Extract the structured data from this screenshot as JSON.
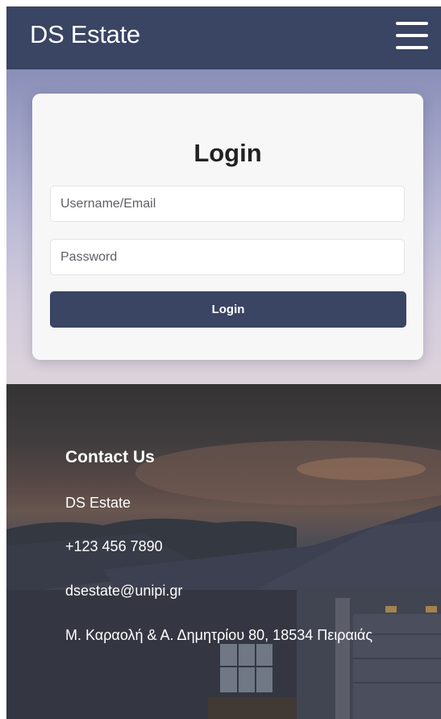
{
  "navbar": {
    "brand": "DS Estate",
    "menu_icon": "hamburger-menu-icon"
  },
  "login": {
    "title": "Login",
    "username_placeholder": "Username/Email",
    "password_placeholder": "Password",
    "button_label": "Login"
  },
  "contact": {
    "title": "Contact Us",
    "company": "DS Estate",
    "phone": "+123 456 7890",
    "email": "dsestate@unipi.gr",
    "address": "Μ. Καραολή & Α. Δημητρίου 80, 18534 Πειραιάς"
  },
  "colors": {
    "navbar_bg": "#3a4463",
    "button_bg": "#3a4463",
    "card_bg": "#f7f7f8"
  }
}
